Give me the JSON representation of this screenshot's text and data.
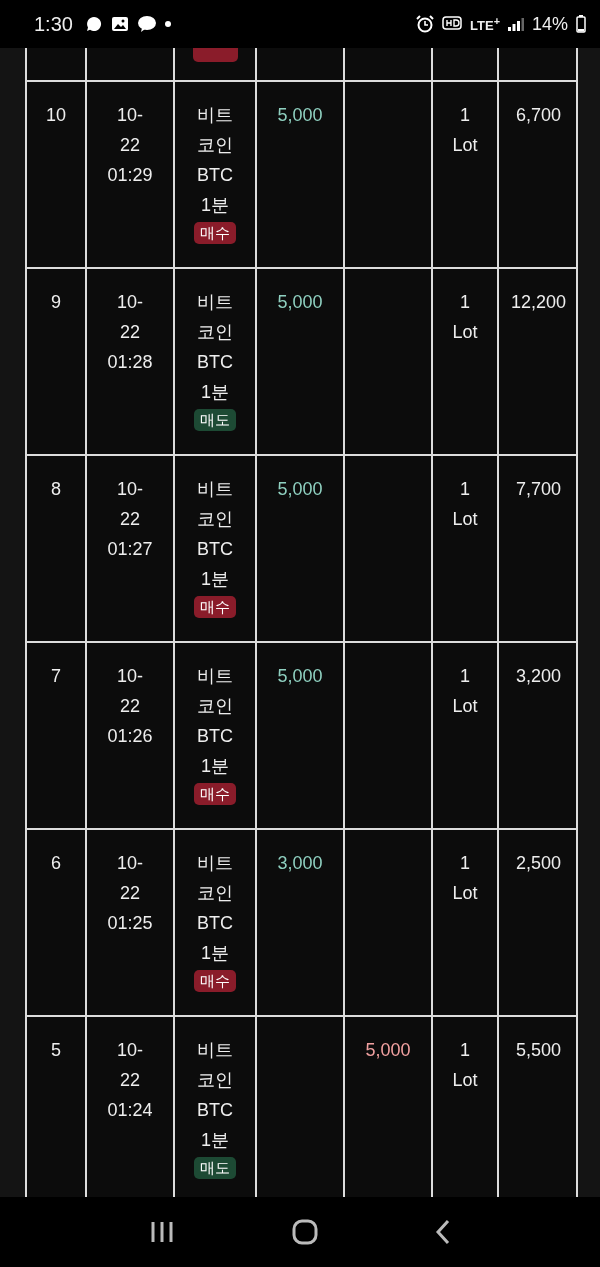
{
  "status_bar": {
    "time": "1:30",
    "network": "LTE$^{+}$",
    "battery": "14%"
  },
  "top_partial_row": {
    "color": "#8a1c2a"
  },
  "rows": [
    {
      "no": "10",
      "date": [
        "10-",
        "22",
        "01:29"
      ],
      "asset": [
        "비트",
        "코인",
        "BTC",
        "1분"
      ],
      "color": "#8a1c2a",
      "side_label": "매수",
      "buy_amount": "5,000",
      "sell_amount": "",
      "qty": [
        "1",
        "Lot"
      ],
      "result": "6,700"
    },
    {
      "no": "9",
      "date": [
        "10-",
        "22",
        "01:28"
      ],
      "asset": [
        "비트",
        "코인",
        "BTC",
        "1분"
      ],
      "color": "#1d4a34",
      "side_label": "매도",
      "buy_amount": "5,000",
      "sell_amount": "",
      "qty": [
        "1",
        "Lot"
      ],
      "result": "12,200"
    },
    {
      "no": "8",
      "date": [
        "10-",
        "22",
        "01:27"
      ],
      "asset": [
        "비트",
        "코인",
        "BTC",
        "1분"
      ],
      "color": "#8a1c2a",
      "side_label": "매수",
      "buy_amount": "5,000",
      "sell_amount": "",
      "qty": [
        "1",
        "Lot"
      ],
      "result": "7,700"
    },
    {
      "no": "7",
      "date": [
        "10-",
        "22",
        "01:26"
      ],
      "asset": [
        "비트",
        "코인",
        "BTC",
        "1분"
      ],
      "color": "#8a1c2a",
      "side_label": "매수",
      "buy_amount": "5,000",
      "sell_amount": "",
      "qty": [
        "1",
        "Lot"
      ],
      "result": "3,200"
    },
    {
      "no": "6",
      "date": [
        "10-",
        "22",
        "01:25"
      ],
      "asset": [
        "비트",
        "코인",
        "BTC",
        "1분"
      ],
      "color": "#8a1c2a",
      "side_label": "매수",
      "buy_amount": "3,000",
      "sell_amount": "",
      "qty": [
        "1",
        "Lot"
      ],
      "result": "2,500"
    },
    {
      "no": "5",
      "date": [
        "10-",
        "22",
        "01:24"
      ],
      "asset": [
        "비트",
        "코인",
        "BTC",
        "1분"
      ],
      "color": "#1d4a34",
      "side_label": "매도",
      "buy_amount": "",
      "sell_amount": "5,000",
      "qty": [
        "1",
        "Lot"
      ],
      "result": "5,500"
    }
  ]
}
